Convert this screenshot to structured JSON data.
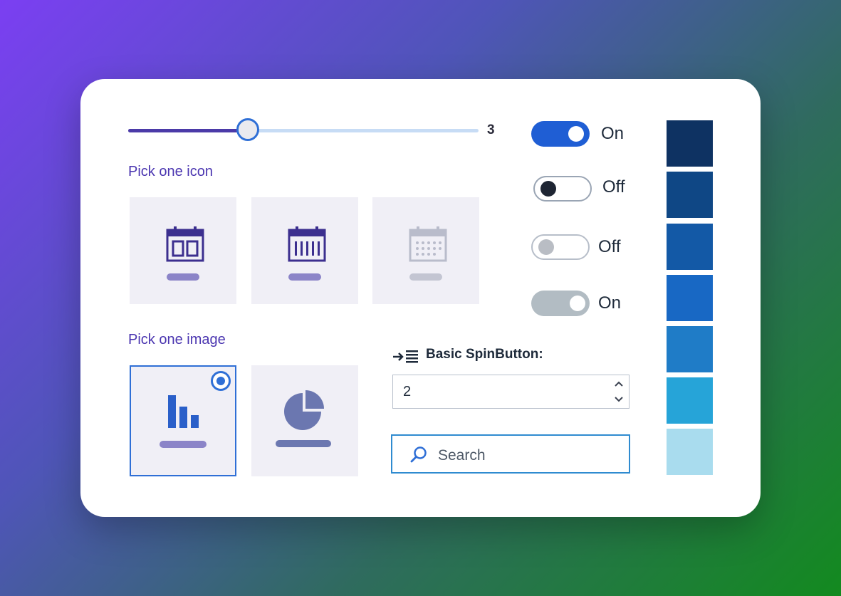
{
  "slider": {
    "value": "3",
    "fill_fraction": 0.35
  },
  "pick_icon": {
    "label": "Pick one icon",
    "icons": [
      {
        "name": "calendar-week-icon",
        "state": "enabled"
      },
      {
        "name": "calendar-month-icon",
        "state": "enabled"
      },
      {
        "name": "calendar-grid-icon",
        "state": "disabled"
      }
    ]
  },
  "pick_image": {
    "label": "Pick one image",
    "images": [
      {
        "name": "bar-chart-icon",
        "selected": true
      },
      {
        "name": "pie-chart-icon",
        "selected": false
      }
    ]
  },
  "toggles": [
    {
      "label": "On",
      "state": "on",
      "style": "accent"
    },
    {
      "label": "Off",
      "state": "off",
      "style": "default"
    },
    {
      "label": "Off",
      "state": "off",
      "style": "disabled"
    },
    {
      "label": "On",
      "state": "on",
      "style": "disabled"
    }
  ],
  "spin": {
    "label": "Basic SpinButton:",
    "value": "2",
    "icon": "indent-icon"
  },
  "search": {
    "placeholder": "Search",
    "icon": "search-icon"
  },
  "swatches": [
    "#0e3262",
    "#0f4785",
    "#1359a6",
    "#1868c4",
    "#1f7cc7",
    "#26a4d8",
    "#a9dcee"
  ],
  "colors": {
    "accent": "#2f6fd6",
    "brand_purple": "#4a35b0"
  }
}
